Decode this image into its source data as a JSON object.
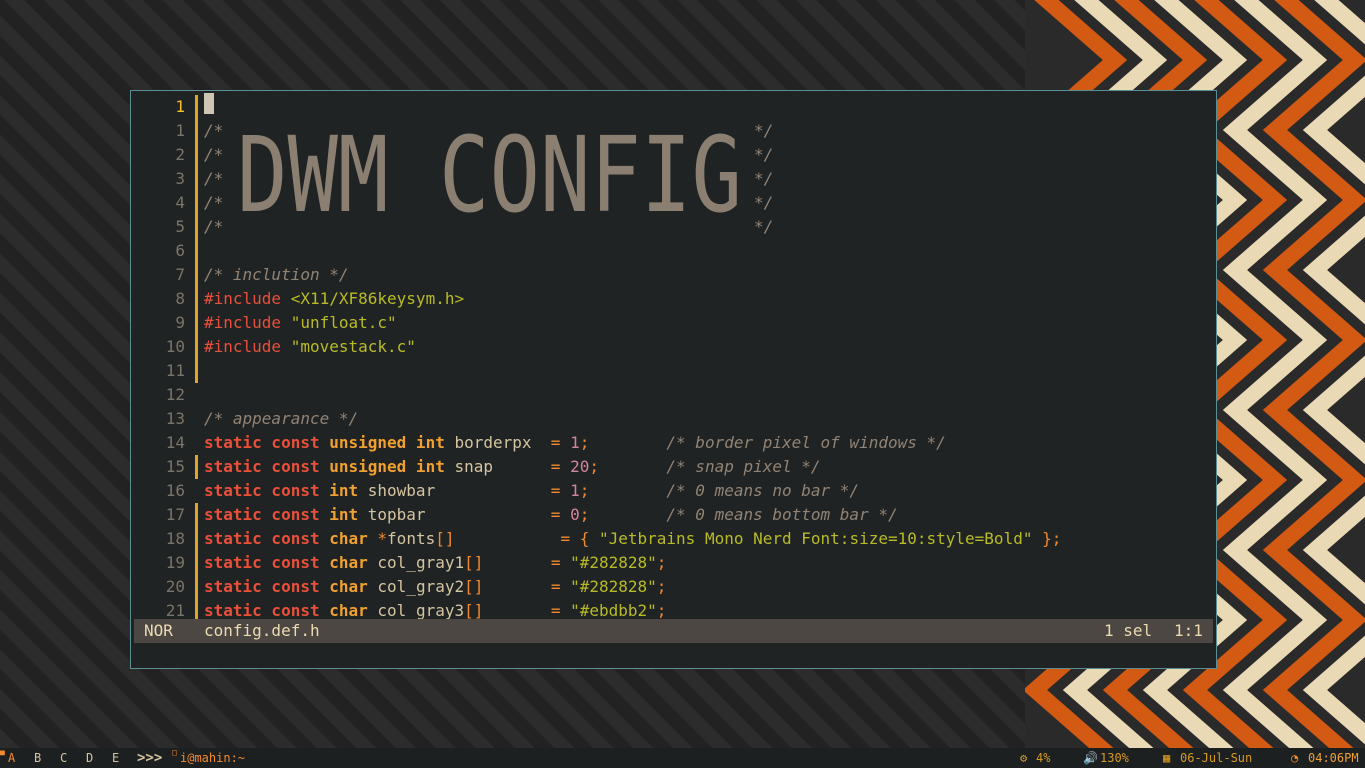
{
  "editor": {
    "banner_text": "DWM CONFIG",
    "mode": "NOR",
    "filename": "config.def.h",
    "selection": "1 sel",
    "position": "1:1",
    "lines": [
      {
        "n": "1",
        "cur": true,
        "bar": true,
        "tokens": []
      },
      {
        "n": "1",
        "bar": true,
        "tokens": [
          [
            "cmt",
            "/*"
          ],
          [
            "cmtend",
            "*/"
          ]
        ]
      },
      {
        "n": "2",
        "bar": true,
        "tokens": [
          [
            "cmt",
            "/*"
          ],
          [
            "cmtend",
            "*/"
          ]
        ]
      },
      {
        "n": "3",
        "bar": true,
        "tokens": [
          [
            "cmt",
            "/*"
          ],
          [
            "cmtend",
            "*/"
          ]
        ]
      },
      {
        "n": "4",
        "bar": true,
        "tokens": [
          [
            "cmt",
            "/*"
          ],
          [
            "cmtend",
            "*/"
          ]
        ]
      },
      {
        "n": "5",
        "bar": true,
        "tokens": [
          [
            "cmt",
            "/*"
          ],
          [
            "cmtend",
            "*/"
          ]
        ]
      },
      {
        "n": "6",
        "bar": true,
        "tokens": []
      },
      {
        "n": "7",
        "bar": true,
        "tokens": [
          [
            "cmt",
            "/* inclution */"
          ]
        ]
      },
      {
        "n": "8",
        "bar": true,
        "tokens": [
          [
            "inc",
            "#include "
          ],
          [
            "str",
            "<X11/XF86keysym.h>"
          ]
        ]
      },
      {
        "n": "9",
        "bar": true,
        "tokens": [
          [
            "inc",
            "#include "
          ],
          [
            "str",
            "\"unfloat.c\""
          ]
        ]
      },
      {
        "n": "10",
        "bar": true,
        "tokens": [
          [
            "inc",
            "#include "
          ],
          [
            "str",
            "\"movestack.c\""
          ]
        ]
      },
      {
        "n": "11",
        "bar": true,
        "tokens": []
      },
      {
        "n": "12",
        "bar": false,
        "tokens": []
      },
      {
        "n": "13",
        "bar": false,
        "tokens": [
          [
            "cmt",
            "/* appearance */"
          ]
        ]
      },
      {
        "n": "14",
        "bar": false,
        "tokens": [
          [
            "kw",
            "static const "
          ],
          [
            "ty",
            "unsigned int "
          ],
          [
            "id",
            "borderpx  "
          ],
          [
            "op",
            "= "
          ],
          [
            "num",
            "1"
          ],
          [
            "op",
            ";"
          ],
          [
            "id",
            "        "
          ],
          [
            "cmt",
            "/* border pixel of windows */"
          ]
        ]
      },
      {
        "n": "15",
        "bar": true,
        "tokens": [
          [
            "kw",
            "static const "
          ],
          [
            "ty",
            "unsigned int "
          ],
          [
            "id",
            "snap      "
          ],
          [
            "op",
            "= "
          ],
          [
            "num",
            "20"
          ],
          [
            "op",
            ";"
          ],
          [
            "id",
            "       "
          ],
          [
            "cmt",
            "/* snap pixel */"
          ]
        ]
      },
      {
        "n": "16",
        "bar": false,
        "tokens": [
          [
            "kw",
            "static const "
          ],
          [
            "ty",
            "int "
          ],
          [
            "id",
            "showbar            "
          ],
          [
            "op",
            "= "
          ],
          [
            "num",
            "1"
          ],
          [
            "op",
            ";"
          ],
          [
            "id",
            "        "
          ],
          [
            "cmt",
            "/* 0 means no bar */"
          ]
        ]
      },
      {
        "n": "17",
        "bar": true,
        "tokens": [
          [
            "kw",
            "static const "
          ],
          [
            "ty",
            "int "
          ],
          [
            "id",
            "topbar             "
          ],
          [
            "op",
            "= "
          ],
          [
            "num",
            "0"
          ],
          [
            "op",
            ";"
          ],
          [
            "id",
            "        "
          ],
          [
            "cmt",
            "/* 0 means bottom bar */"
          ]
        ]
      },
      {
        "n": "18",
        "bar": true,
        "tokens": [
          [
            "kw",
            "static const "
          ],
          [
            "ty",
            "char "
          ],
          [
            "op",
            "*"
          ],
          [
            "id",
            "fonts"
          ],
          [
            "brk",
            "[]"
          ],
          [
            "id",
            "           "
          ],
          [
            "op",
            "= { "
          ],
          [
            "str",
            "\"Jetbrains Mono Nerd Font:size=10:style=Bold\""
          ],
          [
            "op",
            " };"
          ]
        ]
      },
      {
        "n": "19",
        "bar": true,
        "tokens": [
          [
            "kw",
            "static const "
          ],
          [
            "ty",
            "char "
          ],
          [
            "id",
            "col_gray1"
          ],
          [
            "brk",
            "[]"
          ],
          [
            "id",
            "       "
          ],
          [
            "op",
            "= "
          ],
          [
            "str",
            "\"#282828\""
          ],
          [
            "op",
            ";"
          ]
        ]
      },
      {
        "n": "20",
        "bar": true,
        "tokens": [
          [
            "kw",
            "static const "
          ],
          [
            "ty",
            "char "
          ],
          [
            "id",
            "col_gray2"
          ],
          [
            "brk",
            "[]"
          ],
          [
            "id",
            "       "
          ],
          [
            "op",
            "= "
          ],
          [
            "str",
            "\"#282828\""
          ],
          [
            "op",
            ";"
          ]
        ]
      },
      {
        "n": "21",
        "bar": true,
        "tokens": [
          [
            "kw",
            "static const "
          ],
          [
            "ty",
            "char "
          ],
          [
            "id",
            "col_gray3"
          ],
          [
            "brk",
            "[]"
          ],
          [
            "id",
            "       "
          ],
          [
            "op",
            "= "
          ],
          [
            "str",
            "\"#ebdbb2\""
          ],
          [
            "op",
            ";"
          ]
        ]
      }
    ]
  },
  "bar": {
    "workspaces": [
      "A",
      "B",
      "C",
      "D",
      "E"
    ],
    "active_workspace": "A",
    "layout_symbol": ">>>",
    "title": "i@mahin:~",
    "cpu": "4%",
    "volume": "130%",
    "date": "06-Jul-Sun",
    "time": "04:06PM"
  },
  "colors": {
    "accent": "#f38a2e",
    "gutter": "#e0a526",
    "window_border": "#5a8f95",
    "status_bg": "#4c4743"
  }
}
